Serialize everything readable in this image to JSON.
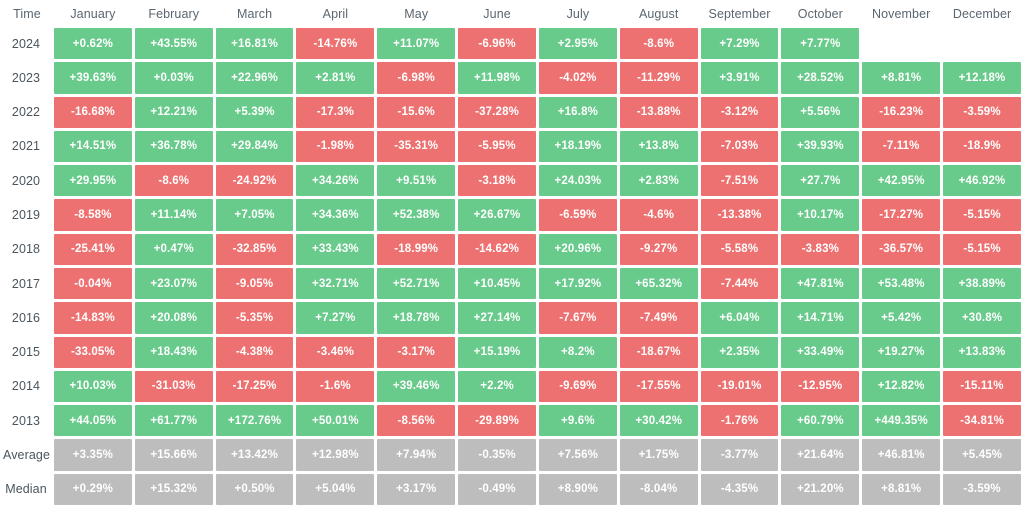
{
  "table": {
    "row_header_label": "Time",
    "columns": [
      "January",
      "February",
      "March",
      "April",
      "May",
      "June",
      "July",
      "August",
      "September",
      "October",
      "November",
      "December"
    ],
    "colors": {
      "positive": "#68ca8b",
      "negative": "#ed7171",
      "summary": "#bdbdbd",
      "empty": "#ffffff",
      "text": "#ffffff",
      "header_text": "#5b6670"
    },
    "rows": [
      {
        "label": "2024",
        "kind": "year",
        "values": [
          "+0.62%",
          "+43.55%",
          "+16.81%",
          "-14.76%",
          "+11.07%",
          "-6.96%",
          "+2.95%",
          "-8.6%",
          "+7.29%",
          "+7.77%",
          "",
          ""
        ]
      },
      {
        "label": "2023",
        "kind": "year",
        "values": [
          "+39.63%",
          "+0.03%",
          "+22.96%",
          "+2.81%",
          "-6.98%",
          "+11.98%",
          "-4.02%",
          "-11.29%",
          "+3.91%",
          "+28.52%",
          "+8.81%",
          "+12.18%"
        ]
      },
      {
        "label": "2022",
        "kind": "year",
        "values": [
          "-16.68%",
          "+12.21%",
          "+5.39%",
          "-17.3%",
          "-15.6%",
          "-37.28%",
          "+16.8%",
          "-13.88%",
          "-3.12%",
          "+5.56%",
          "-16.23%",
          "-3.59%"
        ]
      },
      {
        "label": "2021",
        "kind": "year",
        "values": [
          "+14.51%",
          "+36.78%",
          "+29.84%",
          "-1.98%",
          "-35.31%",
          "-5.95%",
          "+18.19%",
          "+13.8%",
          "-7.03%",
          "+39.93%",
          "-7.11%",
          "-18.9%"
        ]
      },
      {
        "label": "2020",
        "kind": "year",
        "values": [
          "+29.95%",
          "-8.6%",
          "-24.92%",
          "+34.26%",
          "+9.51%",
          "-3.18%",
          "+24.03%",
          "+2.83%",
          "-7.51%",
          "+27.7%",
          "+42.95%",
          "+46.92%"
        ]
      },
      {
        "label": "2019",
        "kind": "year",
        "values": [
          "-8.58%",
          "+11.14%",
          "+7.05%",
          "+34.36%",
          "+52.38%",
          "+26.67%",
          "-6.59%",
          "-4.6%",
          "-13.38%",
          "+10.17%",
          "-17.27%",
          "-5.15%"
        ]
      },
      {
        "label": "2018",
        "kind": "year",
        "values": [
          "-25.41%",
          "+0.47%",
          "-32.85%",
          "+33.43%",
          "-18.99%",
          "-14.62%",
          "+20.96%",
          "-9.27%",
          "-5.58%",
          "-3.83%",
          "-36.57%",
          "-5.15%"
        ]
      },
      {
        "label": "2017",
        "kind": "year",
        "values": [
          "-0.04%",
          "+23.07%",
          "-9.05%",
          "+32.71%",
          "+52.71%",
          "+10.45%",
          "+17.92%",
          "+65.32%",
          "-7.44%",
          "+47.81%",
          "+53.48%",
          "+38.89%"
        ]
      },
      {
        "label": "2016",
        "kind": "year",
        "values": [
          "-14.83%",
          "+20.08%",
          "-5.35%",
          "+7.27%",
          "+18.78%",
          "+27.14%",
          "-7.67%",
          "-7.49%",
          "+6.04%",
          "+14.71%",
          "+5.42%",
          "+30.8%"
        ]
      },
      {
        "label": "2015",
        "kind": "year",
        "values": [
          "-33.05%",
          "+18.43%",
          "-4.38%",
          "-3.46%",
          "-3.17%",
          "+15.19%",
          "+8.2%",
          "-18.67%",
          "+2.35%",
          "+33.49%",
          "+19.27%",
          "+13.83%"
        ]
      },
      {
        "label": "2014",
        "kind": "year",
        "values": [
          "+10.03%",
          "-31.03%",
          "-17.25%",
          "-1.6%",
          "+39.46%",
          "+2.2%",
          "-9.69%",
          "-17.55%",
          "-19.01%",
          "-12.95%",
          "+12.82%",
          "-15.11%"
        ]
      },
      {
        "label": "2013",
        "kind": "year",
        "values": [
          "+44.05%",
          "+61.77%",
          "+172.76%",
          "+50.01%",
          "-8.56%",
          "-29.89%",
          "+9.6%",
          "+30.42%",
          "-1.76%",
          "+60.79%",
          "+449.35%",
          "-34.81%"
        ]
      },
      {
        "label": "Average",
        "kind": "summary",
        "values": [
          "+3.35%",
          "+15.66%",
          "+13.42%",
          "+12.98%",
          "+7.94%",
          "-0.35%",
          "+7.56%",
          "+1.75%",
          "-3.77%",
          "+21.64%",
          "+46.81%",
          "+5.45%"
        ]
      },
      {
        "label": "Median",
        "kind": "summary",
        "values": [
          "+0.29%",
          "+15.32%",
          "+0.50%",
          "+5.04%",
          "+3.17%",
          "-0.49%",
          "+8.90%",
          "-8.04%",
          "-4.35%",
          "+21.20%",
          "+8.81%",
          "-3.59%"
        ]
      }
    ]
  },
  "chart_data": {
    "type": "heatmap",
    "title": "",
    "xlabel": "",
    "ylabel": "Time",
    "x_categories": [
      "January",
      "February",
      "March",
      "April",
      "May",
      "June",
      "July",
      "August",
      "September",
      "October",
      "November",
      "December"
    ],
    "y_categories": [
      "2024",
      "2023",
      "2022",
      "2021",
      "2020",
      "2019",
      "2018",
      "2017",
      "2016",
      "2015",
      "2014",
      "2013",
      "Average",
      "Median"
    ],
    "unit": "percent",
    "color_scale": {
      "positive": "#68ca8b",
      "negative": "#ed7171",
      "summary_rows": "#bdbdbd"
    },
    "values": [
      [
        0.62,
        43.55,
        16.81,
        -14.76,
        11.07,
        -6.96,
        2.95,
        -8.6,
        7.29,
        7.77,
        null,
        null
      ],
      [
        39.63,
        0.03,
        22.96,
        2.81,
        -6.98,
        11.98,
        -4.02,
        -11.29,
        3.91,
        28.52,
        8.81,
        12.18
      ],
      [
        -16.68,
        12.21,
        5.39,
        -17.3,
        -15.6,
        -37.28,
        16.8,
        -13.88,
        -3.12,
        5.56,
        -16.23,
        -3.59
      ],
      [
        14.51,
        36.78,
        29.84,
        -1.98,
        -35.31,
        -5.95,
        18.19,
        13.8,
        -7.03,
        39.93,
        -7.11,
        -18.9
      ],
      [
        29.95,
        -8.6,
        -24.92,
        34.26,
        9.51,
        -3.18,
        24.03,
        2.83,
        -7.51,
        27.7,
        42.95,
        46.92
      ],
      [
        -8.58,
        11.14,
        7.05,
        34.36,
        52.38,
        26.67,
        -6.59,
        -4.6,
        -13.38,
        10.17,
        -17.27,
        -5.15
      ],
      [
        -25.41,
        0.47,
        -32.85,
        33.43,
        -18.99,
        -14.62,
        20.96,
        -9.27,
        -5.58,
        -3.83,
        -36.57,
        -5.15
      ],
      [
        -0.04,
        23.07,
        -9.05,
        32.71,
        52.71,
        10.45,
        17.92,
        65.32,
        -7.44,
        47.81,
        53.48,
        38.89
      ],
      [
        -14.83,
        20.08,
        -5.35,
        7.27,
        18.78,
        27.14,
        -7.67,
        -7.49,
        6.04,
        14.71,
        5.42,
        30.8
      ],
      [
        -33.05,
        18.43,
        -4.38,
        -3.46,
        -3.17,
        15.19,
        8.2,
        -18.67,
        2.35,
        33.49,
        19.27,
        13.83
      ],
      [
        10.03,
        -31.03,
        -17.25,
        -1.6,
        39.46,
        2.2,
        -9.69,
        -17.55,
        -19.01,
        -12.95,
        12.82,
        -15.11
      ],
      [
        44.05,
        61.77,
        172.76,
        50.01,
        -8.56,
        -29.89,
        9.6,
        30.42,
        -1.76,
        60.79,
        449.35,
        -34.81
      ],
      [
        3.35,
        15.66,
        13.42,
        12.98,
        7.94,
        -0.35,
        7.56,
        1.75,
        -3.77,
        21.64,
        46.81,
        5.45
      ],
      [
        0.29,
        15.32,
        0.5,
        5.04,
        3.17,
        -0.49,
        8.9,
        -8.04,
        -4.35,
        21.2,
        8.81,
        -3.59
      ]
    ]
  }
}
